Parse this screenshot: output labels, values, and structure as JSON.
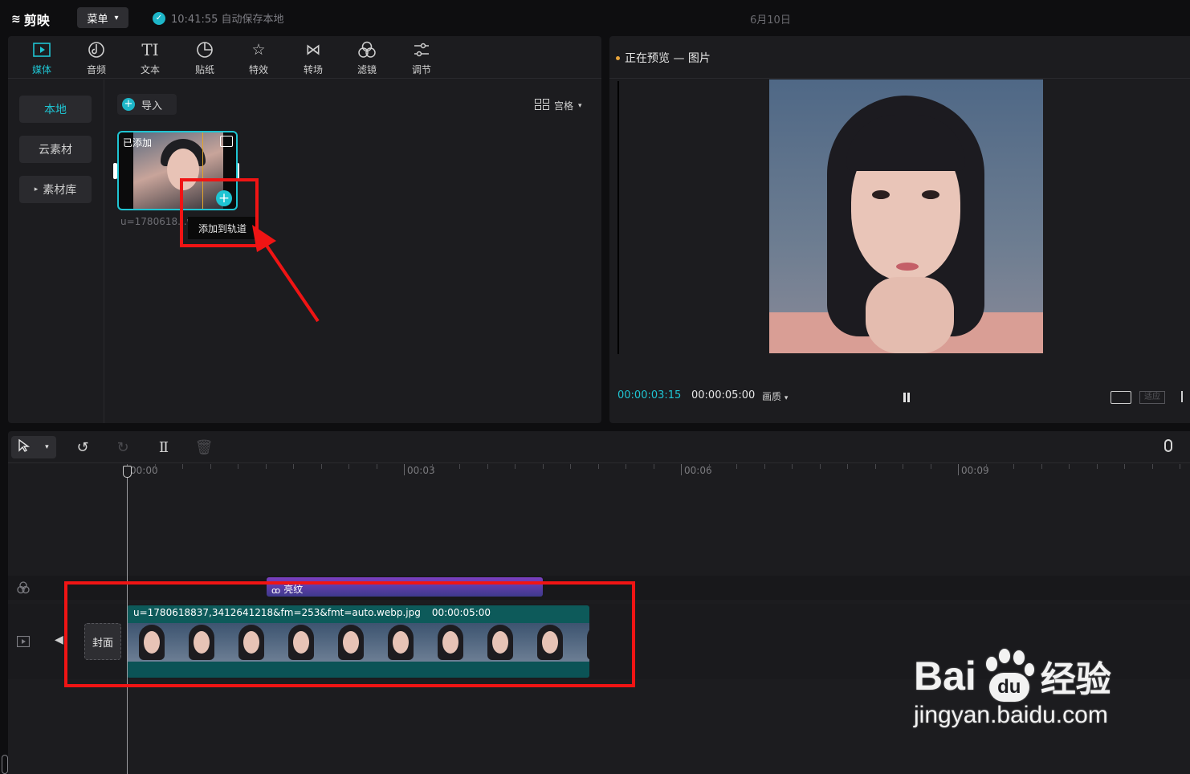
{
  "app": {
    "logo": "剪映",
    "menu_label": "菜单",
    "save_status": "10:41:55 自动保存本地",
    "date": "6月10日"
  },
  "media_panel": {
    "tools": [
      {
        "label": "媒体",
        "icon": "media-icon"
      },
      {
        "label": "音频",
        "icon": "audio-icon"
      },
      {
        "label": "文本",
        "icon": "text-icon"
      },
      {
        "label": "贴纸",
        "icon": "sticker-icon"
      },
      {
        "label": "特效",
        "icon": "effects-icon"
      },
      {
        "label": "转场",
        "icon": "transition-icon"
      },
      {
        "label": "滤镜",
        "icon": "filter-icon"
      },
      {
        "label": "调节",
        "icon": "adjust-icon"
      }
    ],
    "sidebar": [
      {
        "label": "本地"
      },
      {
        "label": "云素材"
      },
      {
        "label": "素材库"
      }
    ],
    "import_label": "导入",
    "view_label": "宫格",
    "thumbnail": {
      "added_badge": "已添加",
      "file_name": "u=1780618...w",
      "tooltip": "添加到轨道"
    }
  },
  "preview": {
    "title": "正在预览 — 图片",
    "current_time": "00:00:03:15",
    "total_time": "00:00:05:00",
    "quality_label": "画质",
    "fit_label": "适应"
  },
  "timeline": {
    "ruler_labels": [
      "00:00",
      "00:03",
      "00:06",
      "00:09"
    ],
    "effect_clip_label": "亮纹",
    "cover_label": "封面",
    "clip": {
      "file_name": "u=1780618837,3412641218&fm=253&fmt=auto.webp.jpg",
      "duration": "00:00:05:00"
    }
  },
  "watermark": {
    "brand": "Bai",
    "brand_suffix": "经验",
    "brand_du": "du",
    "url": "jingyan.baidu.com"
  },
  "colors": {
    "accent": "#1fc4d2",
    "annotation_red": "#f01414"
  }
}
